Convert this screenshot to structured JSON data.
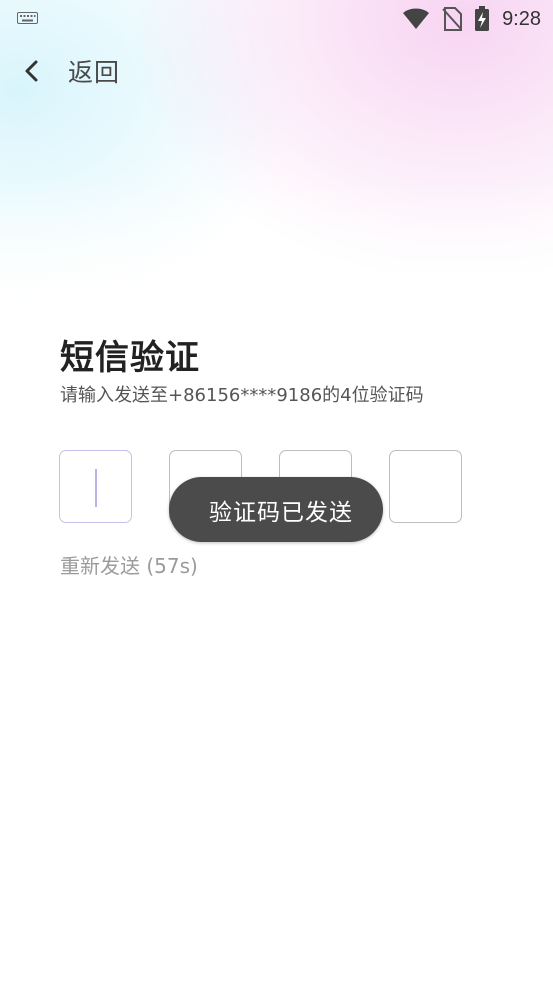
{
  "status_bar": {
    "time": "9:28",
    "icons": [
      "keyboard-icon",
      "wifi-icon",
      "no-sim-icon",
      "battery-charging-icon"
    ]
  },
  "header": {
    "back_label": "返回"
  },
  "main": {
    "title": "短信验证",
    "subtitle": "请输入发送至+86156****9186的4位验证码",
    "code_length": 4,
    "code_values": [
      "",
      "",
      "",
      ""
    ],
    "resend_label": "重新发送 (57s)"
  },
  "toast": {
    "message": "验证码已发送"
  },
  "colors": {
    "background": "#ffffff",
    "title": "#222222",
    "toast_bg": "#4b4b4b",
    "cursor": "#b9b3ea",
    "muted": "#9b9b9b"
  }
}
